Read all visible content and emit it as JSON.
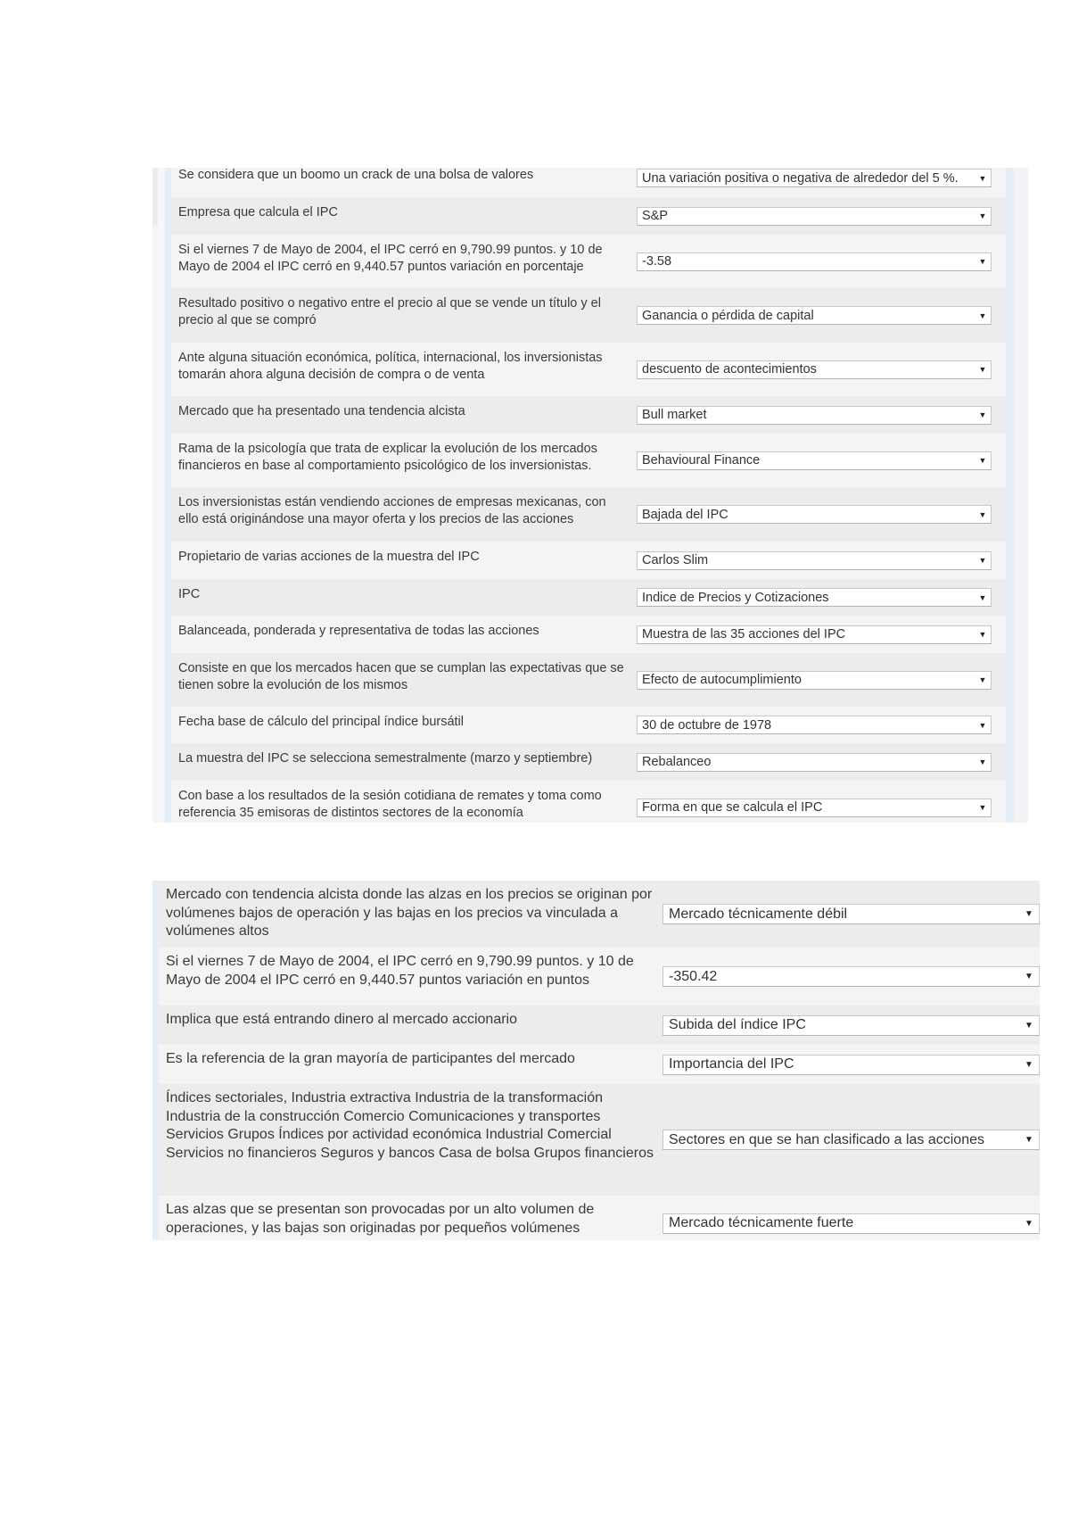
{
  "panel1": {
    "rows": [
      {
        "question": "Se considera que un boomo un crack de una bolsa de valores",
        "answer": "Una variación positiva o negativa de alrededor del 5 %."
      },
      {
        "question": "Empresa que calcula el IPC",
        "answer": "S&P"
      },
      {
        "question": "Si el viernes 7 de Mayo de 2004, el IPC cerró en 9,790.99 puntos. y 10 de Mayo de 2004 el IPC cerró en 9,440.57 puntos  variación en porcentaje",
        "answer": "-3.58"
      },
      {
        "question": "Resultado positivo o negativo entre el precio al que se vende un título y el precio al que se compró",
        "answer": "Ganancia o pérdida de capital"
      },
      {
        "question": "Ante alguna situación económica, política, internacional,  los inversionistas tomarán ahora alguna decisión de compra o de venta",
        "answer": "descuento de acontecimientos"
      },
      {
        "question": "Mercado que ha presentado una tendencia alcista",
        "answer": "Bull market"
      },
      {
        "question": "Rama de la psicología que trata de explicar la evolución de los mercados financieros en base al comportamiento psicológico de los inversionistas.",
        "answer": "Behavioural Finance"
      },
      {
        "question": "Los inversionistas están vendiendo acciones de empresas mexicanas, con ello está originándose una mayor oferta y los precios de las acciones",
        "answer": "Bajada del IPC"
      },
      {
        "question": "Propietario de varias acciones de la muestra del IPC",
        "answer": "Carlos Slim"
      },
      {
        "question": "IPC",
        "answer": "Indice de Precios y Cotizaciones"
      },
      {
        "question": "Balanceada, ponderada y representativa de todas las acciones",
        "answer": "Muestra de las 35 acciones del IPC"
      },
      {
        "question": "Consiste en que los mercados hacen que se cumplan las expectativas que se tienen sobre la evolución de los mismos",
        "answer": "Efecto de autocumplimiento"
      },
      {
        "question": "Fecha base de cálculo del principal índice bursátil",
        "answer": "30 de octubre de 1978"
      },
      {
        "question": "La muestra del IPC se selecciona semestralmente (marzo y septiembre)",
        "answer": "Rebalanceo"
      },
      {
        "question": "Con base a los resultados de la sesión cotidiana de remates y toma como referencia 35 emisoras de distintos sectores de la economía",
        "answer": "Forma en que se calcula el IPC"
      }
    ]
  },
  "panel2": {
    "rows": [
      {
        "question": "Mercado con tendencia alcista donde las alzas en los precios se originan por volúmenes bajos de operación y las bajas en los precios va vinculada a volúmenes altos",
        "answer": "Mercado técnicamente débil"
      },
      {
        "question": "Si el viernes 7 de Mayo de 2004, el IPC cerró en 9,790.99 puntos. y 10 de Mayo de 2004 el IPC cerró en 9,440.57 puntos  variación en puntos",
        "answer": "-350.42"
      },
      {
        "question": "Implica que está entrando dinero al mercado accionario",
        "answer": "Subida del índice IPC"
      },
      {
        "question": "Es la referencia de la gran mayoría de participantes del mercado",
        "answer": "Importancia del IPC"
      },
      {
        "question": "Índices sectoriales, Industria extractiva Industria de la transformación Industria de la construcción Comercio Comunicaciones y transportes Servicios Grupos Índices por actividad económica Industrial Comercial Servicios no financieros Seguros y bancos Casa de bolsa Grupos financieros",
        "answer": "Sectores en que se han clasificado a las acciones"
      },
      {
        "question": "Las alzas que se presentan son provocadas por un alto volumen de operaciones, y las bajas son originadas por pequeños volúmenes",
        "answer": "Mercado técnicamente fuerte"
      }
    ]
  },
  "icons": {
    "dropdown_caret": "▼"
  }
}
